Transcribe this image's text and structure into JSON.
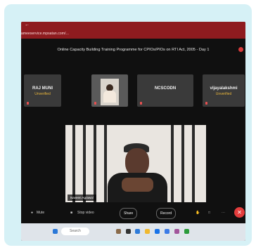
{
  "browser": {
    "url": "ameeservice.mpsatan.com/..."
  },
  "meeting": {
    "title": "Online Capacity Building Training Programme for CPIOs/PIOs on RTI Act, 2005 - Day 1"
  },
  "participants": [
    {
      "name": "RAJ MUNI",
      "status": "Unverified"
    },
    {
      "name": "",
      "status": ""
    },
    {
      "name": "NCSCODN",
      "status": ""
    },
    {
      "name": "vijayalakshmi",
      "status": "Unverified"
    }
  ],
  "speaker": {
    "name": "Naveen Agrawal"
  },
  "controls": {
    "mute": "Mute",
    "stop_video": "Stop video",
    "share": "Share",
    "record": "Record"
  },
  "taskbar": {
    "search_placeholder": "Search"
  },
  "colors": {
    "background": "#d6f1f6",
    "url_bar": "#8e1b1f",
    "end_call": "#e33d3d"
  }
}
